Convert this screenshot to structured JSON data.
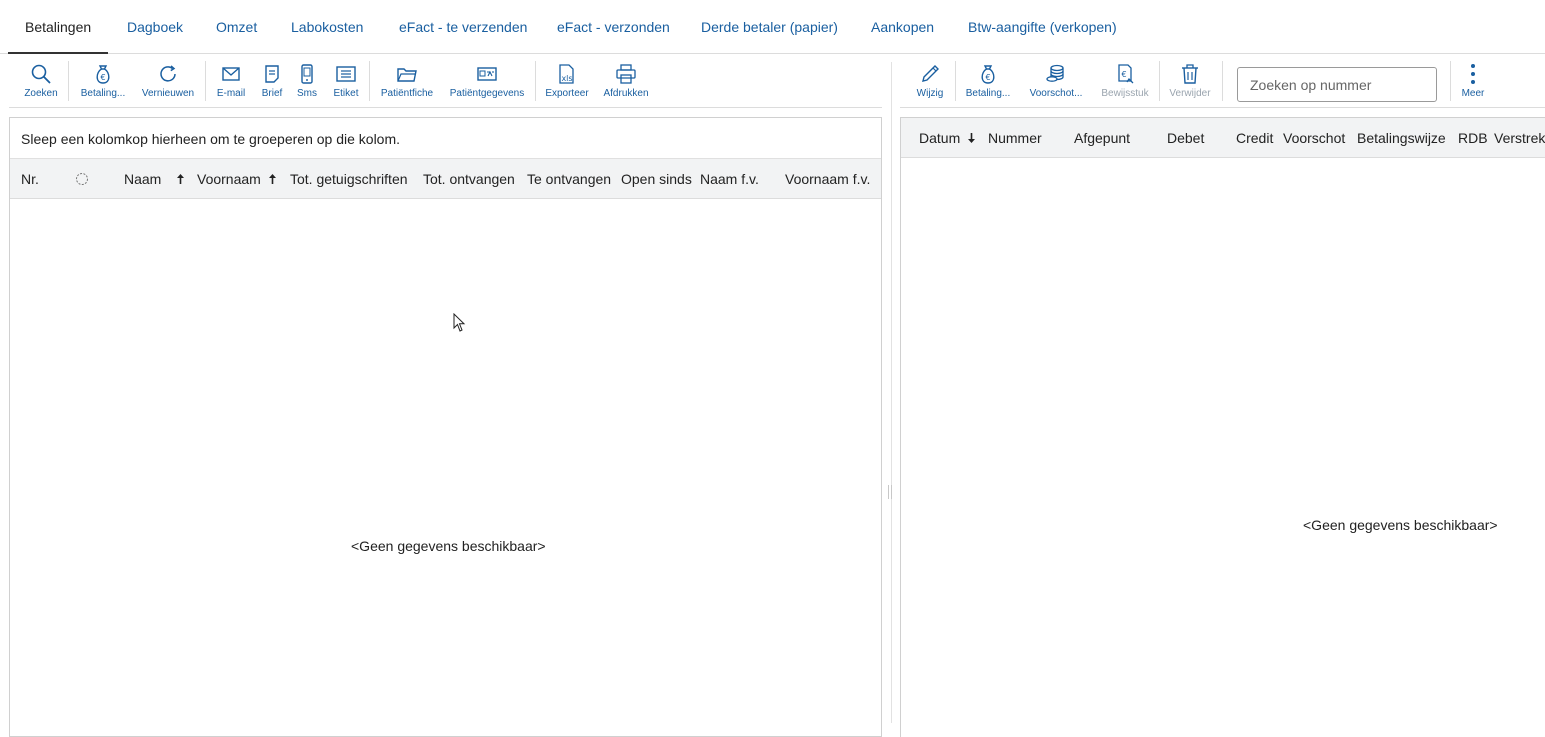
{
  "tabs": [
    {
      "label": "Betalingen",
      "active": true
    },
    {
      "label": "Dagboek"
    },
    {
      "label": "Omzet"
    },
    {
      "label": "Labokosten"
    },
    {
      "label": "eFact - te verzenden"
    },
    {
      "label": "eFact - verzonden"
    },
    {
      "label": "Derde betaler (papier)"
    },
    {
      "label": "Aankopen"
    },
    {
      "label": "Btw-aangifte (verkopen)"
    }
  ],
  "left_toolbar": {
    "zoeken": {
      "label": "Zoeken",
      "icon": "search-icon"
    },
    "betaling": {
      "label": "Betaling...",
      "icon": "money-bag-icon"
    },
    "vernieuwen": {
      "label": "Vernieuwen",
      "icon": "refresh-icon"
    },
    "email": {
      "label": "E-mail",
      "icon": "envelope-icon"
    },
    "brief": {
      "label": "Brief",
      "icon": "document-icon"
    },
    "sms": {
      "label": "Sms",
      "icon": "phone-icon"
    },
    "etiket": {
      "label": "Etiket",
      "icon": "label-icon"
    },
    "patientfiche": {
      "label": "Patiëntfiche",
      "icon": "folder-icon"
    },
    "patientgegevens": {
      "label": "Patiëntgegevens",
      "icon": "id-card-icon"
    },
    "exporteer": {
      "label": "Exporteer",
      "icon": "xls-file-icon"
    },
    "afdrukken": {
      "label": "Afdrukken",
      "icon": "printer-icon"
    }
  },
  "right_toolbar": {
    "wijzig": {
      "label": "Wijzig",
      "icon": "pencil-icon"
    },
    "betaling": {
      "label": "Betaling...",
      "icon": "money-bag-icon"
    },
    "voorschot": {
      "label": "Voorschot...",
      "icon": "coins-icon"
    },
    "bewijsstuk": {
      "label": "Bewijsstuk",
      "icon": "receipt-icon",
      "disabled": true
    },
    "verwijder": {
      "label": "Verwijder",
      "icon": "trash-icon",
      "disabled": true
    },
    "meer": {
      "label": "Meer",
      "icon": "more-vertical-icon"
    }
  },
  "search": {
    "placeholder": "Zoeken op nummer",
    "value": ""
  },
  "left_grid": {
    "group_hint": "Sleep een kolomkop hierheen om te groeperen op die kolom.",
    "columns": [
      "Nr.",
      "",
      "Naam",
      "Voornaam",
      "Tot. getuigschriften",
      "Tot. ontvangen",
      "Te ontvangen",
      "Open sinds",
      "Naam f.v.",
      "Voornaam f.v."
    ],
    "empty_message": "<Geen gegevens beschikbaar>"
  },
  "right_grid": {
    "columns": [
      "Datum",
      "Nummer",
      "Afgepunt",
      "Debet",
      "Credit",
      "Voorschot",
      "Betalingswijze",
      "RDB",
      "Verstrek"
    ],
    "empty_message": "<Geen gegevens beschikbaar>"
  },
  "colors": {
    "accent": "#1a5fa0",
    "disabled": "#9aa4ae",
    "header_bg": "#f2f3f4"
  }
}
